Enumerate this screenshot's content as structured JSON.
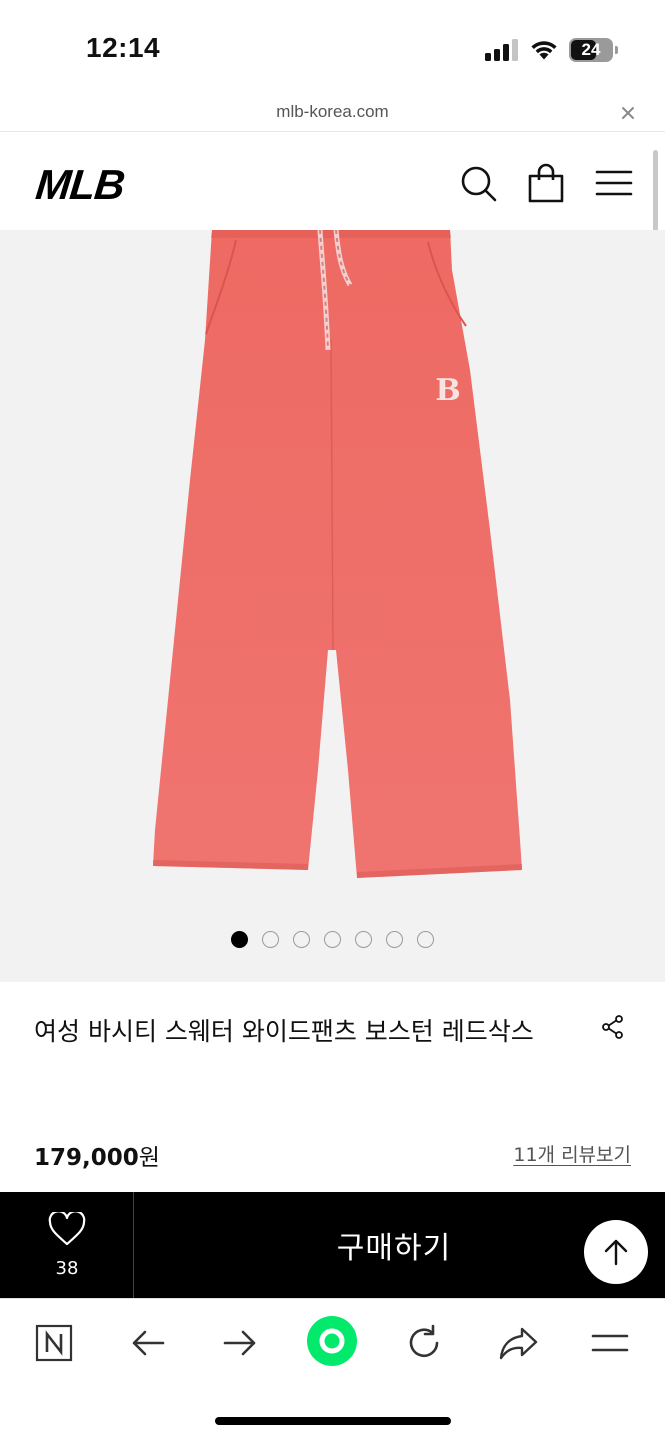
{
  "status_bar": {
    "time": "12:14",
    "battery": "24"
  },
  "browser": {
    "url": "mlb-korea.com"
  },
  "header": {
    "logo": "MLB",
    "icons": [
      "search-icon",
      "shopping-bag-icon",
      "menu-icon"
    ]
  },
  "gallery": {
    "image": "red wide-leg sweater pants with drawstring and B logo",
    "dots_total": 7,
    "active_index": 0
  },
  "product": {
    "title": "여성 바시티 스웨터 와이드팬츠 보스턴 레드삭스",
    "price_number": "179,000",
    "price_unit": "원",
    "review_link": "11개 리뷰보기"
  },
  "buy_bar": {
    "like_count": "38",
    "buy_label": "구매하기"
  },
  "toolbar": {
    "icons": [
      "naver-icon",
      "back-arrow-icon",
      "forward-arrow-icon",
      "green-dot-icon",
      "reload-icon",
      "share-arrow-icon",
      "hamburger-menu-icon"
    ]
  },
  "colors": {
    "product": "#ee6e68",
    "accent_green": "#03e96b",
    "buy_bar": "#000000"
  }
}
